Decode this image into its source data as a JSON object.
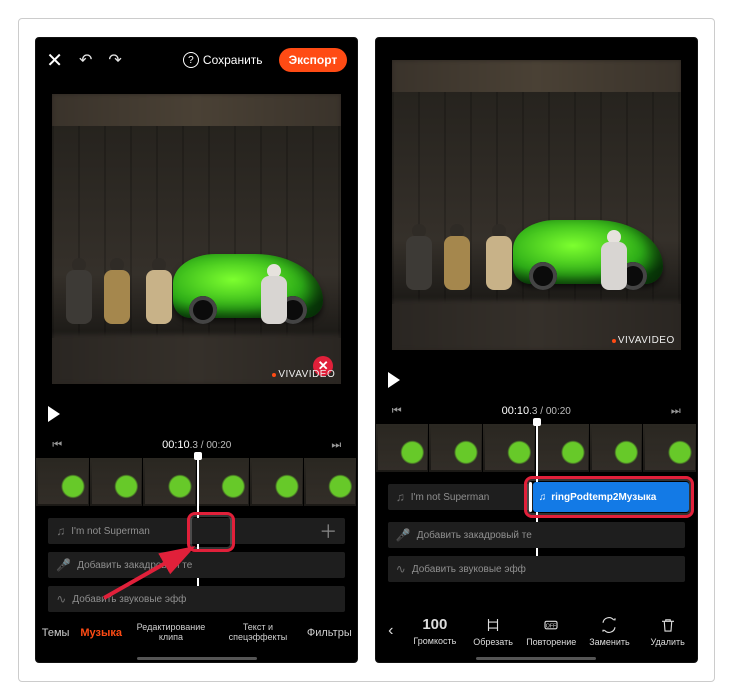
{
  "topbar": {
    "save_label": "Сохранить",
    "export_label": "Экспорт"
  },
  "time": {
    "current": "00:10",
    "current_dec": ".3",
    "total": " / 00:20"
  },
  "tracks": {
    "music_name": "I'm not Superman",
    "voiceover": "Добавить закадровый те",
    "sfx": "Добавить звуковые эфф"
  },
  "tabs": {
    "themes": "Темы",
    "music": "Музыка",
    "clip_editing": "Редактирование клипа",
    "text_fx": "Текст и спецэффекты",
    "filters": "Фильтры"
  },
  "right": {
    "clip_name": "ringPodtemp2Музыка"
  },
  "toolbar": {
    "volume_value": "100",
    "volume": "Громкость",
    "trim": "Обрезать",
    "repeat": "Повторение",
    "replace": "Заменить",
    "delete": "Удалить"
  },
  "watermark": "VIVAVIDEO"
}
